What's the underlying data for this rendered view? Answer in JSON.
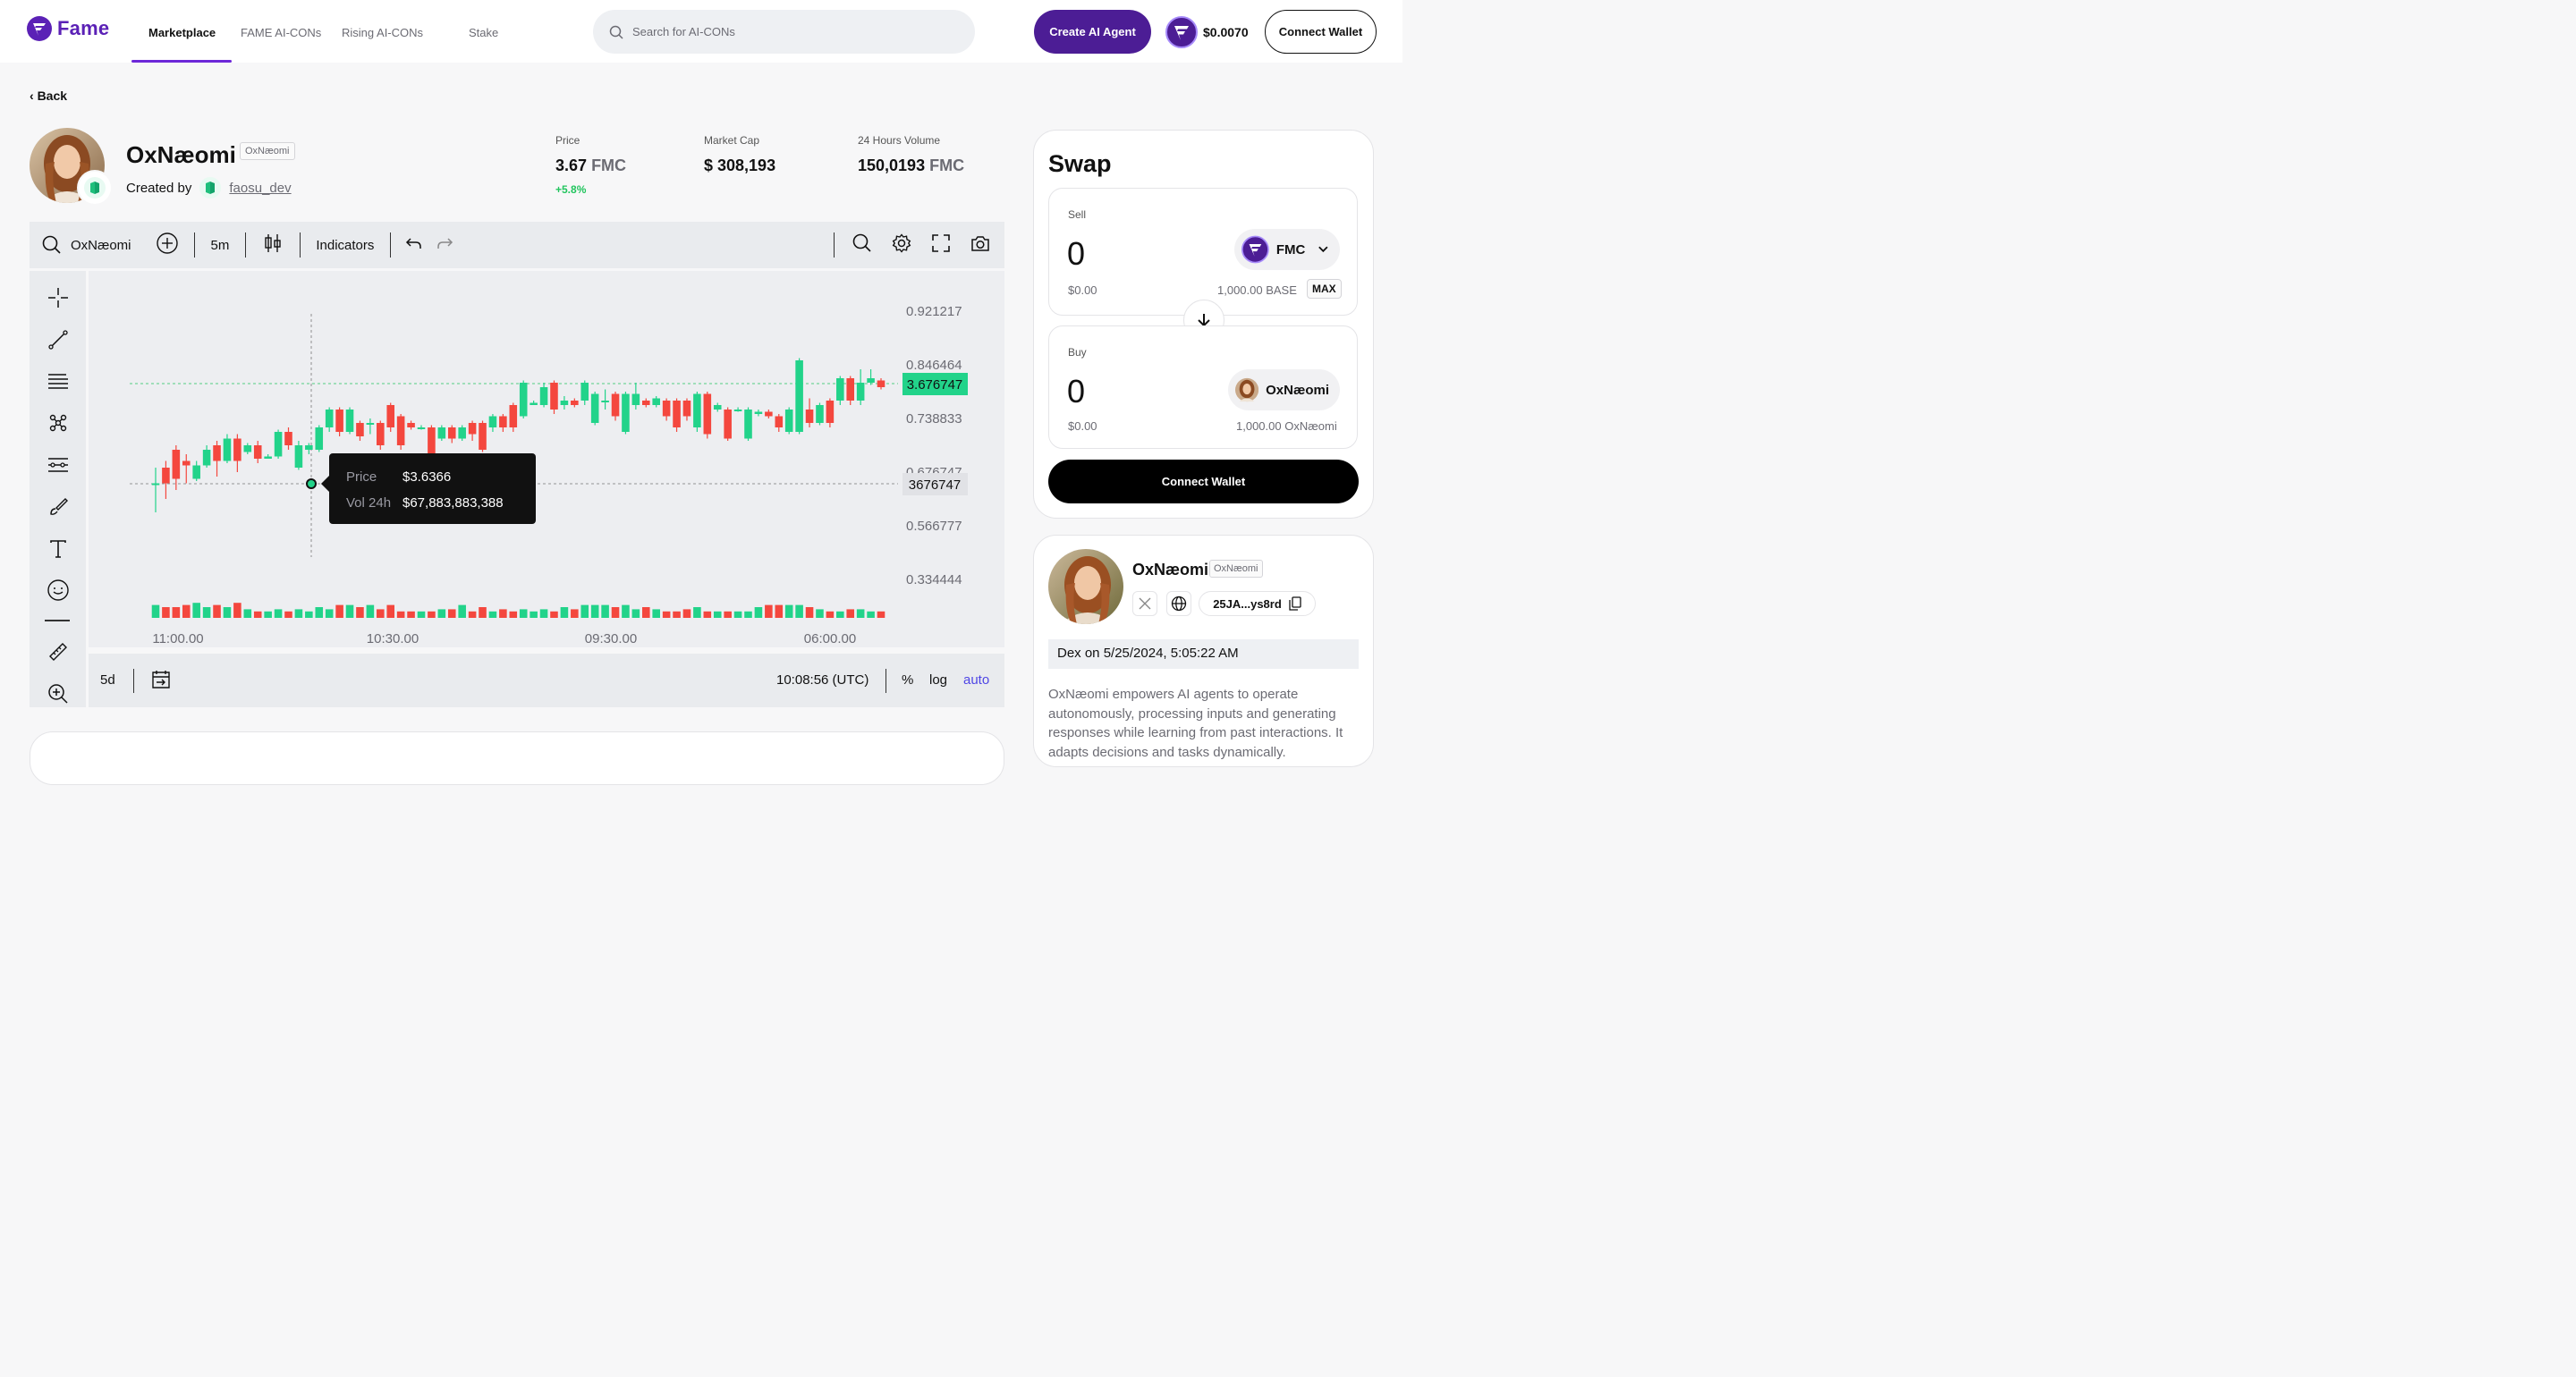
{
  "brand": {
    "name": "Fame",
    "color": "#5b21b6"
  },
  "nav": [
    "Marketplace",
    "FAME AI-CONs",
    "Rising AI-CONs",
    "Stake"
  ],
  "search": {
    "placeholder": "Search for AI-CONs"
  },
  "header": {
    "create_label": "Create AI Agent",
    "fame_price": "$0.0070",
    "connect_label": "Connect Wallet"
  },
  "back_label": "Back",
  "token": {
    "name": "OxNæomi",
    "tag": "OxNæomi",
    "created_by_label": "Created by",
    "creator": "faosu_dev"
  },
  "stats": {
    "price_label": "Price",
    "price_value": "3.67",
    "price_unit": "FMC",
    "price_change": "+5.8%",
    "mcap_label": "Market Cap",
    "mcap_value": "$ 308,193",
    "vol_label": "24 Hours Volume",
    "vol_value": "150,0193",
    "vol_unit": "FMC"
  },
  "toolbar": {
    "symbol": "OxNæomi",
    "interval": "5m",
    "indicators": "Indicators"
  },
  "chart_bottom": {
    "range": "5d",
    "time": "10:08:56 (UTC)",
    "pct": "%",
    "log": "log",
    "auto": "auto"
  },
  "chart_data": {
    "type": "candlestick",
    "y_ticks": [
      "0.921217",
      "0.846464",
      "0.738833",
      "0.676747",
      "0.566777",
      "0.334444"
    ],
    "x_ticks": [
      "11:00.00",
      "10:30.00",
      "09:30.00",
      "06:00.00"
    ],
    "current_price_label": "3.676747",
    "crosshair_price_label": "3676747",
    "tooltip": {
      "price_label": "Price",
      "price_value": "$3.6366",
      "vol_label": "Vol 24h",
      "vol_value": "$67,883,883,388"
    },
    "colors": {
      "up": "#22d38a",
      "down": "#f4473e"
    },
    "candles": [
      [
        0.25,
        0.25,
        0.12,
        0.32
      ],
      [
        0.32,
        0.25,
        0.18,
        0.35
      ],
      [
        0.4,
        0.27,
        0.22,
        0.42
      ],
      [
        0.35,
        0.33,
        0.25,
        0.38
      ],
      [
        0.27,
        0.33,
        0.26,
        0.35
      ],
      [
        0.33,
        0.4,
        0.32,
        0.42
      ],
      [
        0.42,
        0.35,
        0.28,
        0.44
      ],
      [
        0.35,
        0.45,
        0.34,
        0.47
      ],
      [
        0.45,
        0.35,
        0.3,
        0.47
      ],
      [
        0.39,
        0.42,
        0.38,
        0.43
      ],
      [
        0.42,
        0.36,
        0.34,
        0.44
      ],
      [
        0.36,
        0.37,
        0.36,
        0.38
      ],
      [
        0.37,
        0.48,
        0.36,
        0.49
      ],
      [
        0.48,
        0.42,
        0.4,
        0.5
      ],
      [
        0.32,
        0.42,
        0.31,
        0.44
      ],
      [
        0.4,
        0.42,
        0.38,
        0.43
      ],
      [
        0.4,
        0.5,
        0.39,
        0.51
      ],
      [
        0.5,
        0.58,
        0.48,
        0.59
      ],
      [
        0.58,
        0.48,
        0.46,
        0.59
      ],
      [
        0.48,
        0.58,
        0.47,
        0.59
      ],
      [
        0.52,
        0.46,
        0.44,
        0.53
      ],
      [
        0.52,
        0.52,
        0.47,
        0.54
      ],
      [
        0.52,
        0.42,
        0.4,
        0.53
      ],
      [
        0.6,
        0.5,
        0.48,
        0.61
      ],
      [
        0.55,
        0.42,
        0.4,
        0.56
      ],
      [
        0.52,
        0.5,
        0.49,
        0.53
      ],
      [
        0.5,
        0.5,
        0.49,
        0.51
      ],
      [
        0.5,
        0.38,
        0.36,
        0.51
      ],
      [
        0.45,
        0.5,
        0.44,
        0.51
      ],
      [
        0.5,
        0.45,
        0.43,
        0.51
      ],
      [
        0.45,
        0.5,
        0.44,
        0.51
      ],
      [
        0.52,
        0.47,
        0.44,
        0.53
      ],
      [
        0.52,
        0.4,
        0.39,
        0.53
      ],
      [
        0.5,
        0.55,
        0.48,
        0.56
      ],
      [
        0.55,
        0.5,
        0.48,
        0.56
      ],
      [
        0.6,
        0.5,
        0.48,
        0.61
      ],
      [
        0.55,
        0.7,
        0.54,
        0.71
      ],
      [
        0.6,
        0.61,
        0.6,
        0.62
      ],
      [
        0.6,
        0.68,
        0.59,
        0.7
      ],
      [
        0.7,
        0.58,
        0.56,
        0.71
      ],
      [
        0.6,
        0.62,
        0.58,
        0.64
      ],
      [
        0.62,
        0.6,
        0.59,
        0.63
      ],
      [
        0.62,
        0.7,
        0.6,
        0.71
      ],
      [
        0.52,
        0.65,
        0.51,
        0.66
      ],
      [
        0.62,
        0.62,
        0.58,
        0.67
      ],
      [
        0.65,
        0.55,
        0.53,
        0.66
      ],
      [
        0.48,
        0.65,
        0.47,
        0.66
      ],
      [
        0.6,
        0.65,
        0.58,
        0.7
      ],
      [
        0.62,
        0.6,
        0.59,
        0.63
      ],
      [
        0.6,
        0.63,
        0.59,
        0.64
      ],
      [
        0.62,
        0.55,
        0.53,
        0.63
      ],
      [
        0.62,
        0.5,
        0.48,
        0.63
      ],
      [
        0.62,
        0.55,
        0.53,
        0.63
      ],
      [
        0.5,
        0.65,
        0.48,
        0.66
      ],
      [
        0.65,
        0.47,
        0.45,
        0.66
      ],
      [
        0.58,
        0.6,
        0.57,
        0.61
      ],
      [
        0.58,
        0.45,
        0.44,
        0.59
      ],
      [
        0.58,
        0.58,
        0.57,
        0.59
      ],
      [
        0.45,
        0.58,
        0.44,
        0.59
      ],
      [
        0.56,
        0.57,
        0.55,
        0.58
      ],
      [
        0.57,
        0.55,
        0.54,
        0.58
      ],
      [
        0.55,
        0.5,
        0.48,
        0.56
      ],
      [
        0.48,
        0.58,
        0.47,
        0.59
      ],
      [
        0.48,
        0.8,
        0.47,
        0.81
      ],
      [
        0.58,
        0.52,
        0.5,
        0.63
      ],
      [
        0.52,
        0.6,
        0.51,
        0.61
      ],
      [
        0.62,
        0.52,
        0.5,
        0.63
      ],
      [
        0.62,
        0.72,
        0.6,
        0.73
      ],
      [
        0.72,
        0.62,
        0.6,
        0.73
      ],
      [
        0.62,
        0.7,
        0.6,
        0.76
      ],
      [
        0.7,
        0.72,
        0.69,
        0.76
      ],
      [
        0.71,
        0.68,
        0.67,
        0.72
      ]
    ],
    "volumes": [
      0.6,
      0.5,
      0.5,
      0.6,
      0.7,
      0.5,
      0.6,
      0.5,
      0.7,
      0.4,
      0.3,
      0.3,
      0.4,
      0.3,
      0.4,
      0.3,
      0.5,
      0.4,
      0.6,
      0.6,
      0.5,
      0.6,
      0.4,
      0.6,
      0.3,
      0.3,
      0.3,
      0.3,
      0.4,
      0.4,
      0.6,
      0.3,
      0.5,
      0.3,
      0.4,
      0.3,
      0.4,
      0.3,
      0.4,
      0.3,
      0.5,
      0.4,
      0.6,
      0.6,
      0.6,
      0.5,
      0.6,
      0.4,
      0.5,
      0.4,
      0.3,
      0.3,
      0.4,
      0.5,
      0.3,
      0.3,
      0.3,
      0.3,
      0.3,
      0.5,
      0.6,
      0.6,
      0.6,
      0.6,
      0.5,
      0.4,
      0.3,
      0.3,
      0.4,
      0.4,
      0.3,
      0.3
    ]
  },
  "swap": {
    "title": "Swap",
    "sell_label": "Sell",
    "sell_amount": "0",
    "sell_usd": "$0.00",
    "sell_token": "FMC",
    "sell_balance": "1,000.00 BASE",
    "max_label": "MAX",
    "buy_label": "Buy",
    "buy_amount": "0",
    "buy_usd": "$0.00",
    "buy_token": "OxNæomi",
    "buy_balance": "1,000.00 OxNæomi",
    "connect_label": "Connect Wallet"
  },
  "info": {
    "name": "OxNæomi",
    "tag": "OxNæomi",
    "address": "25JA...ys8rd",
    "dex": "Dex on 5/25/2024, 5:05:22 AM",
    "description": "OxNæomi empowers AI agents to operate autonomously, processing inputs and generating responses while learning from past interactions. It adapts decisions and tasks dynamically."
  }
}
